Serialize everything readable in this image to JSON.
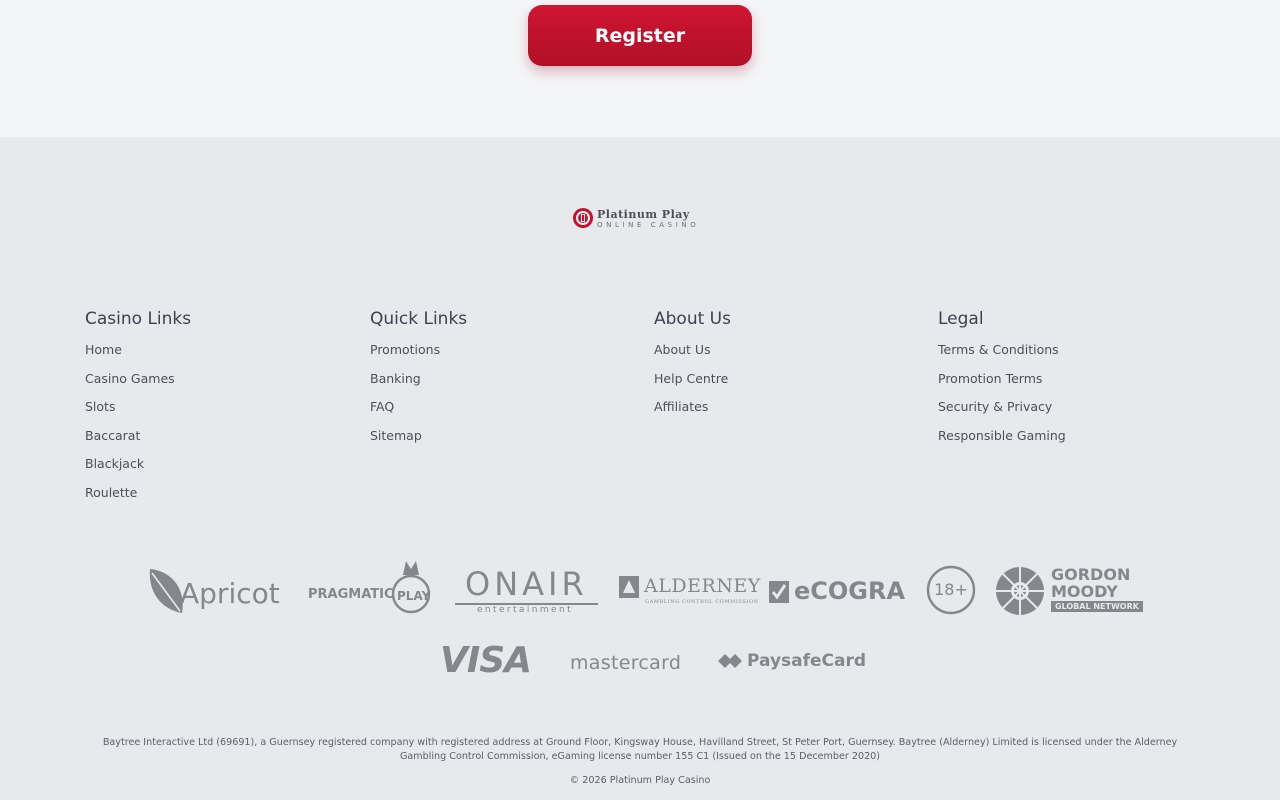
{
  "cta": {
    "register_label": "Register"
  },
  "brand": {
    "logo_title": "Platinum Play",
    "logo_subtitle": "ONLINE CASINO"
  },
  "columns": [
    {
      "heading": "Casino Links",
      "links": [
        "Home",
        "Casino Games",
        "Slots",
        "Baccarat",
        "Blackjack",
        "Roulette"
      ]
    },
    {
      "heading": "Quick Links",
      "links": [
        "Promotions",
        "Banking",
        "FAQ",
        "Sitemap"
      ]
    },
    {
      "heading": "About Us",
      "links": [
        "About Us",
        "Help Centre",
        "Affiliates"
      ]
    },
    {
      "heading": "Legal",
      "links": [
        "Terms & Conditions",
        "Promotion Terms",
        "Security & Privacy",
        "Responsible Gaming"
      ]
    }
  ],
  "partners": {
    "apricot": "Apricot",
    "pragmatic": "PRAGMATIC",
    "pragmatic_play": "PLAY",
    "onair": "ONAIR",
    "onair_sub": "entertainment",
    "alderney": "ALDERNEY",
    "alderney_sub": "GAMBLING CONTROL COMMISSION",
    "ecogra": "eCOGRA",
    "age": "18+",
    "gordon": "GORDON",
    "moody": "MOODY",
    "gordon_sub": "GLOBAL NETWORK"
  },
  "payments": {
    "visa": "VISA",
    "mastercard": "mastercard",
    "paysafecard": "PaysafeCard"
  },
  "footer": {
    "legal_text": "Baytree Interactive Ltd (69691), a Guernsey registered company with registered address at Ground Floor, Kingsway House, Havilland Street, St Peter Port, Guernsey. Baytree (Alderney) Limited is licensed under the Alderney Gambling Control Commission, eGaming license number 155 C1 (Issued on the 15 December 2020)",
    "copyright": "© 2026 Platinum Play Casino"
  },
  "colors": {
    "brand_red": "#c8102e",
    "logo_gray": "#7d7f84",
    "background": "#e8e9ec",
    "top_band": "#f4f5f7"
  }
}
